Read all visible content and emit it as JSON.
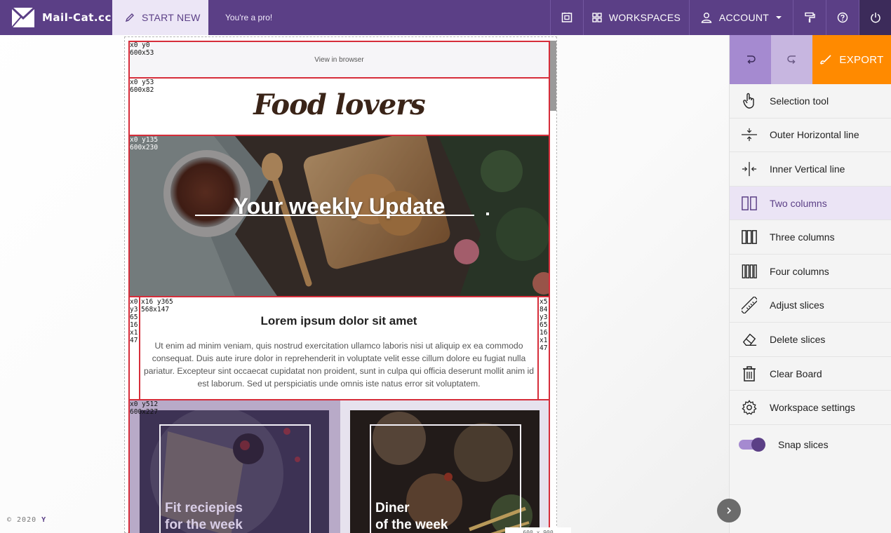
{
  "topbar": {
    "brand": "Mail-Cat.cc",
    "start_new": "START NEW",
    "tagline": "You're a pro!",
    "workspaces": "WORKSPACES",
    "account": "ACCOUNT"
  },
  "canvas": {
    "labels": {
      "browser": "x0 y0\n600x53",
      "logo": "x0 y53\n600x82",
      "hero": "x0 y135\n600x230",
      "text_left": "x0\ny3\n65\n16\nx1\n47",
      "text_center": "x16 y365\n568x147",
      "text_right": "x5\n84\ny3\n65\n16\nx1\n47",
      "cards": "x0 y512\n600x227"
    },
    "view_in_browser": "View in browser",
    "logo_text": "Food lovers",
    "hero_title": "Your weekly Update",
    "content_title": "Lorem ipsum dolor sit amet",
    "content_body": "Ut enim ad minim veniam, quis nostrud exercitation ullamco laboris nisi ut aliquip ex ea commodo consequat. Duis aute irure dolor in reprehenderit in voluptate velit esse cillum dolore eu fugiat nulla pariatur. Excepteur sint occaecat cupidatat non proident, sunt in culpa qui officia deserunt mollit anim id est laborum. Sed ut perspiciatis unde omnis iste natus error sit voluptatem.",
    "card_a_title": "Fit reciepies\nfor the week",
    "card_b_title": "Diner\nof the week",
    "size_tag": "600 x 900"
  },
  "panel": {
    "export": "EXPORT",
    "tools": [
      {
        "label": "Selection tool",
        "icon": "hand-pointer-icon"
      },
      {
        "label": "Outer Horizontal line",
        "icon": "horizontal-line-icon"
      },
      {
        "label": "Inner Vertical line",
        "icon": "vertical-line-icon"
      },
      {
        "label": "Two columns",
        "icon": "two-columns-icon"
      },
      {
        "label": "Three columns",
        "icon": "three-columns-icon"
      },
      {
        "label": "Four columns",
        "icon": "four-columns-icon"
      },
      {
        "label": "Adjust slices",
        "icon": "ruler-icon"
      },
      {
        "label": "Delete slices",
        "icon": "eraser-icon"
      },
      {
        "label": "Clear Board",
        "icon": "trash-icon"
      },
      {
        "label": "Workspace settings",
        "icon": "gear-icon"
      }
    ],
    "snap_label": "Snap slices",
    "snap_on": true
  },
  "footer": {
    "copyright": "© 2020",
    "mark": "Y"
  },
  "colors": {
    "brand": "#5b3f86",
    "accent_light": "#a58ad0",
    "export": "#ff8a00",
    "slice_border": "#d62d3a"
  }
}
